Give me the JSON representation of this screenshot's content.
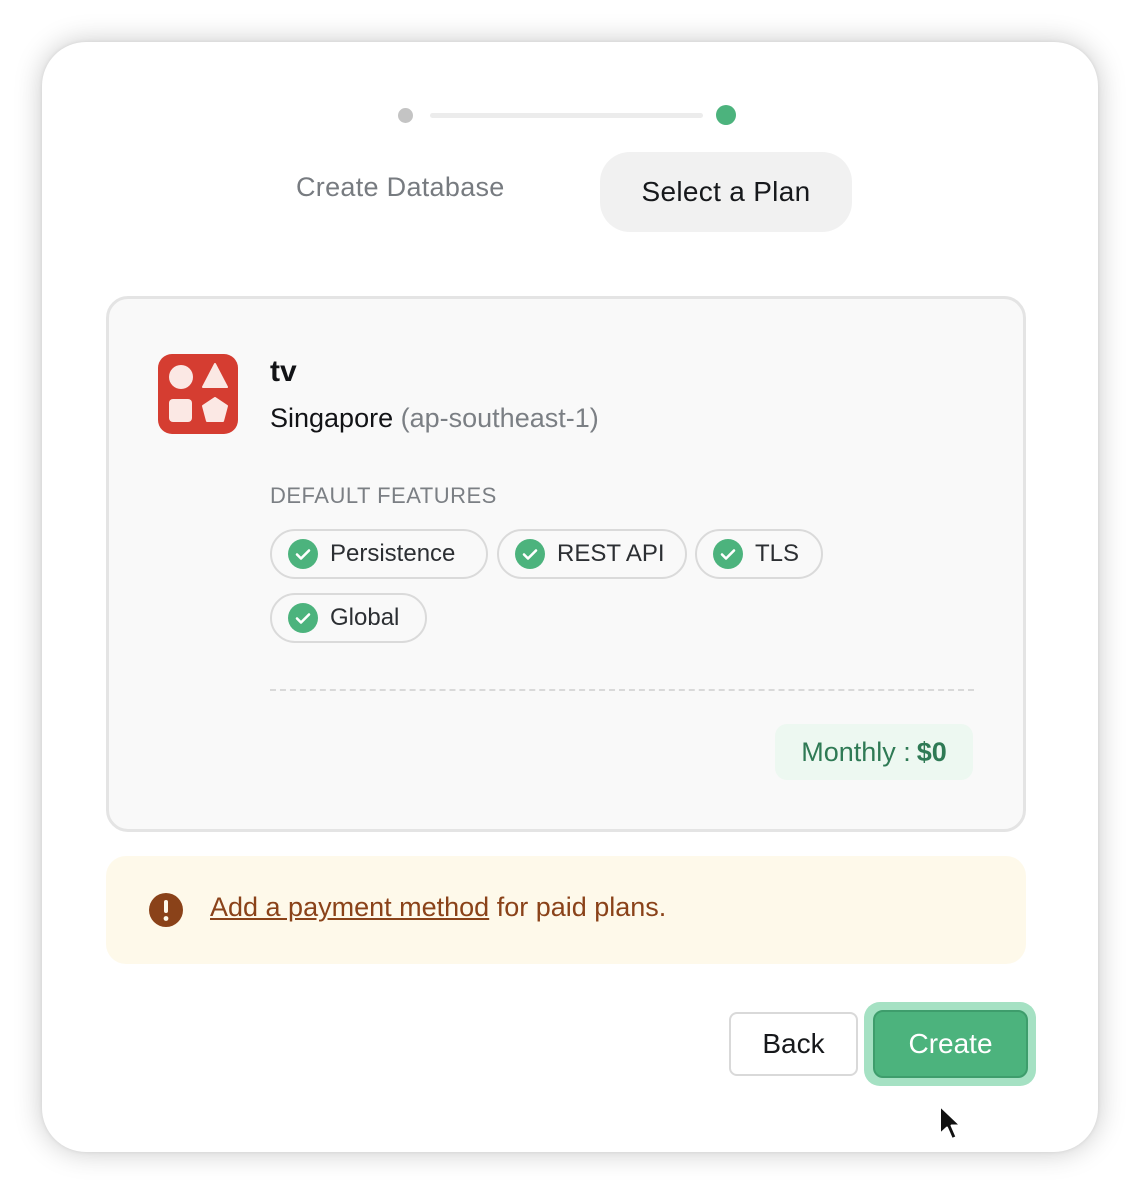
{
  "stepper": {
    "step1_label": "Create Database",
    "step2_label": "Select a Plan"
  },
  "database": {
    "name": "tv",
    "region_name": "Singapore",
    "region_code": "(ap-southeast-1)",
    "icon": "shapes-icon"
  },
  "features": {
    "title": "DEFAULT FEATURES",
    "items": [
      {
        "label": "Persistence",
        "icon": "check-circle-icon"
      },
      {
        "label": "REST API",
        "icon": "check-circle-icon"
      },
      {
        "label": "TLS",
        "icon": "check-circle-icon"
      },
      {
        "label": "Global",
        "icon": "check-circle-icon"
      }
    ]
  },
  "price": {
    "label": "Monthly :",
    "value": "$0"
  },
  "warning": {
    "icon": "exclamation-circle-icon",
    "link_text": "Add a payment method",
    "text": " for paid plans."
  },
  "actions": {
    "back_label": "Back",
    "create_label": "Create"
  },
  "colors": {
    "accent": "#4cb37d",
    "brand_icon": "#d53d31",
    "warning_text": "#8a4219",
    "warning_bg": "#fef9ea"
  }
}
